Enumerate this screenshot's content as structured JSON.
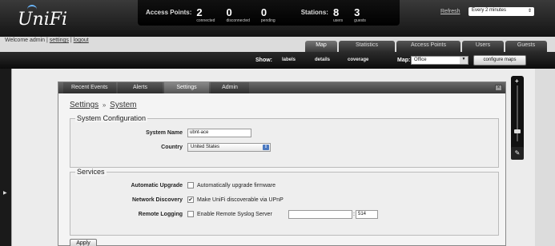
{
  "app": {
    "logo": "UniFi"
  },
  "user": {
    "welcome": "Welcome admin",
    "settings_link": "settings",
    "logout_link": "logout",
    "sep": "|"
  },
  "stats": {
    "access_points_title": "Access Points:",
    "connected": {
      "num": "2",
      "label": "connected"
    },
    "disconnected": {
      "num": "0",
      "label": "disconnected"
    },
    "pending": {
      "num": "0",
      "label": "pending"
    },
    "stations_title": "Stations:",
    "users": {
      "num": "8",
      "label": "users"
    },
    "guests": {
      "num": "3",
      "label": "guests"
    }
  },
  "refresh": {
    "label": "Refresh",
    "value": "Every 2 minutes"
  },
  "nav": {
    "tabs": [
      "Map",
      "Statistics",
      "Access Points",
      "Users",
      "Guests"
    ],
    "active": "Map"
  },
  "showbar": {
    "show_label": "Show:",
    "options": [
      "labels",
      "details",
      "coverage"
    ],
    "map_label": "Map:",
    "map_value": "Office",
    "configure_button": "configure maps"
  },
  "panel": {
    "tabs": [
      "Recent Events",
      "Alerts",
      "Settings",
      "Admin"
    ],
    "active_tab": "Settings",
    "breadcrumb": {
      "root": "Settings",
      "sep": "»",
      "current": "System"
    },
    "system_configuration": {
      "legend": "System Configuration",
      "system_name_label": "System Name",
      "system_name_value": "ubnt-ace",
      "country_label": "Country",
      "country_value": "United States"
    },
    "services": {
      "legend": "Services",
      "auto_upgrade_label": "Automatic Upgrade",
      "auto_upgrade_text": "Automatically upgrade firmware",
      "auto_upgrade_checked": false,
      "network_discovery_label": "Network Discovery",
      "network_discovery_text": "Make UniFi discoverable via UPnP",
      "network_discovery_checked": true,
      "remote_logging_label": "Remote Logging",
      "remote_logging_text": "Enable Remote Syslog Server",
      "remote_logging_checked": false,
      "remote_logging_host": "",
      "remote_logging_port_sep": ":",
      "remote_logging_port": "514"
    },
    "apply_button": "Apply"
  },
  "icons": {
    "close": "close-icon",
    "zoom_in": "plus-icon",
    "zoom_out": "minus-icon",
    "edit": "pen-icon",
    "expand": "chevron-right-icon"
  },
  "colors": {
    "header_bg": "#141414",
    "accent_blue": "#4a78c0"
  }
}
